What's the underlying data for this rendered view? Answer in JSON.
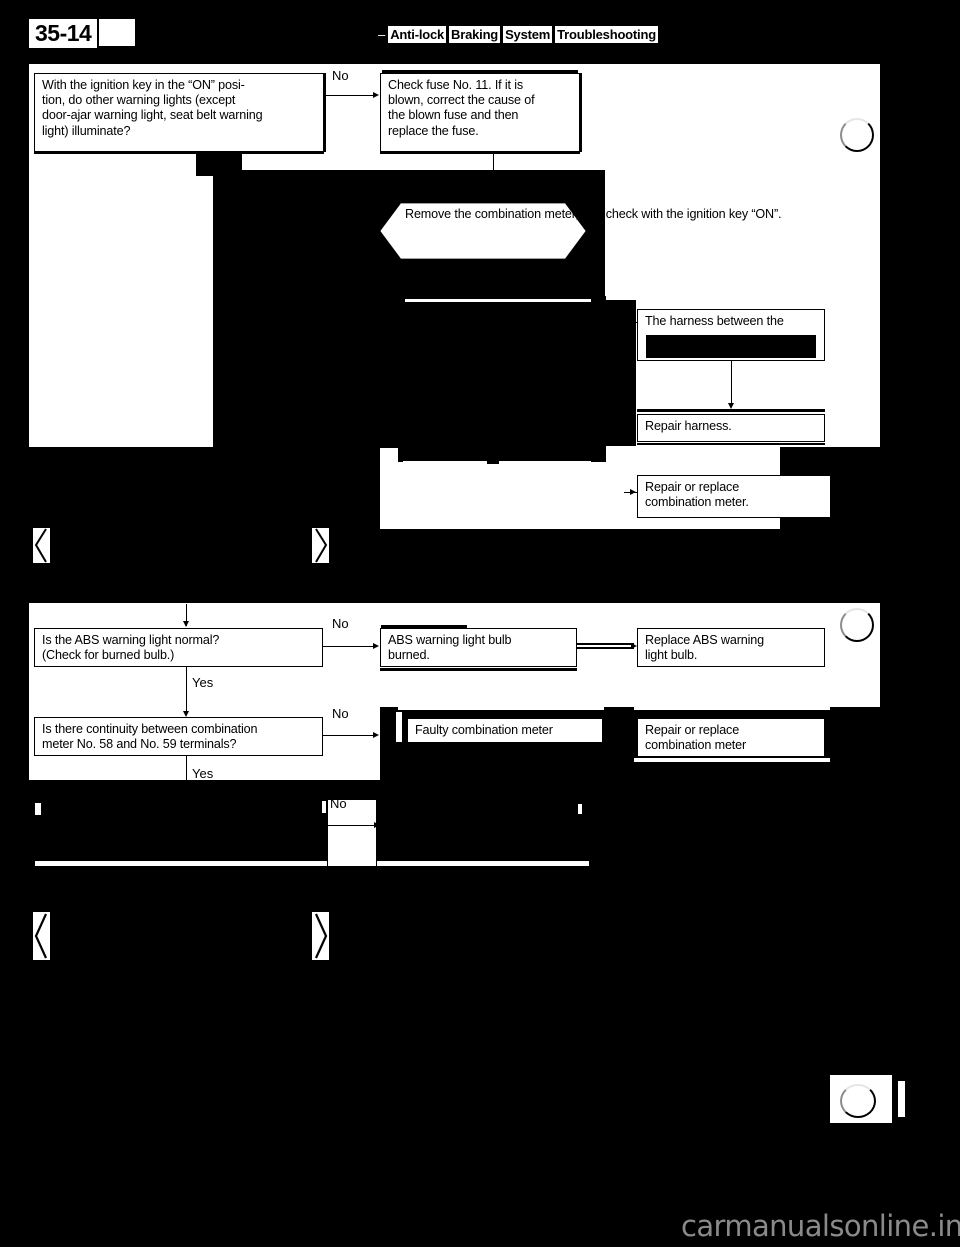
{
  "page": {
    "number": "35-14",
    "header_prefix": "–",
    "header_words": [
      "Anti-lock",
      "Braking",
      "System",
      "Troubleshooting"
    ],
    "header_full": "Anti-lock Braking System Troubleshooting",
    "watermark": "carmanualsonline.info"
  },
  "flow_top": {
    "q1": {
      "lines": [
        "With the ignition key in the “ON” posi-",
        "tion, do other warning lights (except",
        "door-ajar warning light, seat belt warning",
        "light) illuminate?"
      ],
      "branch_no": "No"
    },
    "fuse": {
      "lines": [
        "Check fuse No. 11. If it is",
        "blown, correct the cause of",
        "the blown fuse and then",
        "replace the fuse."
      ]
    },
    "remove_meter": {
      "lines": [
        "Remove the combination",
        "meter, and check with",
        "the ignition key “ON”."
      ]
    },
    "harness": {
      "lines": [
        "The harness between the"
      ],
      "obscured": true
    },
    "repair_harness": {
      "lines": [
        "Repair harness."
      ]
    },
    "repair_replace_meter": {
      "lines": [
        "Repair or replace",
        "combination meter."
      ]
    }
  },
  "flow_bottom": {
    "q2": {
      "lines": [
        "Is the ABS warning light normal?",
        "(Check for burned bulb.)"
      ],
      "branch_no": "No",
      "branch_yes": "Yes"
    },
    "bulb_burned": {
      "lines": [
        "ABS warning light bulb",
        "burned."
      ]
    },
    "replace_bulb": {
      "lines": [
        "Replace ABS warning",
        "light bulb."
      ]
    },
    "q3": {
      "lines": [
        "Is there continuity between combination",
        "meter No. 58 and No. 59 terminals?"
      ],
      "branch_no": "No",
      "branch_yes": "Yes"
    },
    "faulty_meter": {
      "lines": [
        "Faulty combination meter"
      ]
    },
    "repair_replace_meter2": {
      "lines": [
        "Repair or replace",
        "combination meter"
      ]
    },
    "q4": {
      "branch_no": "No",
      "obscured": true
    }
  },
  "colors": {
    "paper": "#ffffff",
    "ink": "#000000",
    "background": "#000000",
    "watermark": "#8a8a8a"
  }
}
